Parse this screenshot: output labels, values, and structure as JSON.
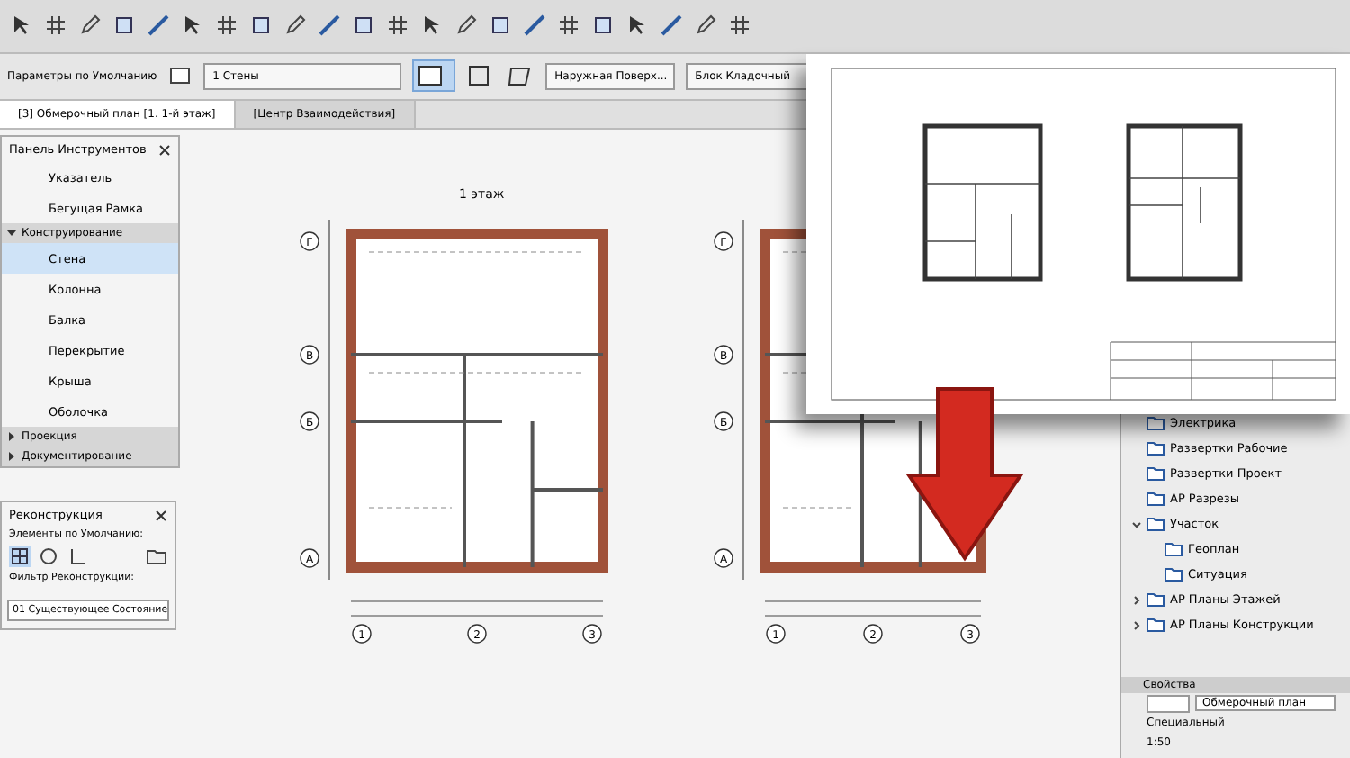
{
  "toolbar": {
    "defaults_label": "Параметры по Умолчанию",
    "layer": "1 Стены",
    "surface": "Наружная Поверх...",
    "material": "Блок Кладочный"
  },
  "tabs": [
    {
      "label": "[3] Обмерочный план [1. 1-й этаж]",
      "selected": true
    },
    {
      "label": "[Центр Взаимодействия]",
      "selected": false
    }
  ],
  "plan_title": "1 этаж",
  "plans": [
    {
      "row_axes": [
        "Г",
        "В",
        "Б",
        "А"
      ],
      "column_axes": [
        "1",
        "2",
        "3"
      ]
    },
    {
      "row_axes": [
        "Г",
        "В",
        "Б",
        "А"
      ],
      "column_axes": [
        "1",
        "2",
        "3"
      ]
    }
  ],
  "toolbox": {
    "title": "Панель Инструментов",
    "tools": [
      {
        "label": "Указатель",
        "selected": false
      },
      {
        "label": "Бегущая Рамка",
        "selected": false
      }
    ],
    "sections": [
      {
        "label": "Конструирование",
        "expanded": true,
        "tools": [
          {
            "label": "Стена",
            "selected": true
          },
          {
            "label": "Колонна",
            "selected": false
          },
          {
            "label": "Балка",
            "selected": false
          },
          {
            "label": "Перекрытие",
            "selected": false
          },
          {
            "label": "Крыша",
            "selected": false
          },
          {
            "label": "Оболочка",
            "selected": false
          }
        ]
      },
      {
        "label": "Проекция",
        "expanded": false
      },
      {
        "label": "Документирование",
        "expanded": false
      }
    ]
  },
  "reconstruction": {
    "title": "Реконструкция",
    "show_label": "Элементы по Умолчанию:",
    "filter_label": "Фильтр Реконструкции:",
    "filter_value": "01 Существующее Состояние"
  },
  "navigator": {
    "items": [
      {
        "label": "Электрика"
      },
      {
        "label": "Развертки Рабочие"
      },
      {
        "label": "Развертки Проект"
      },
      {
        "label": "АР Разрезы"
      },
      {
        "label": "Участок",
        "expanded": true,
        "children": [
          {
            "label": "Геоплан"
          },
          {
            "label": "Ситуация"
          }
        ]
      },
      {
        "label": "АР Планы Этажей",
        "expanded": false
      },
      {
        "label": "АР Планы Конструкции",
        "expanded": false
      }
    ]
  },
  "properties": {
    "title": "Свойства",
    "name": "Обмерочный план",
    "rows": [
      "Специальный",
      "1:50"
    ]
  }
}
